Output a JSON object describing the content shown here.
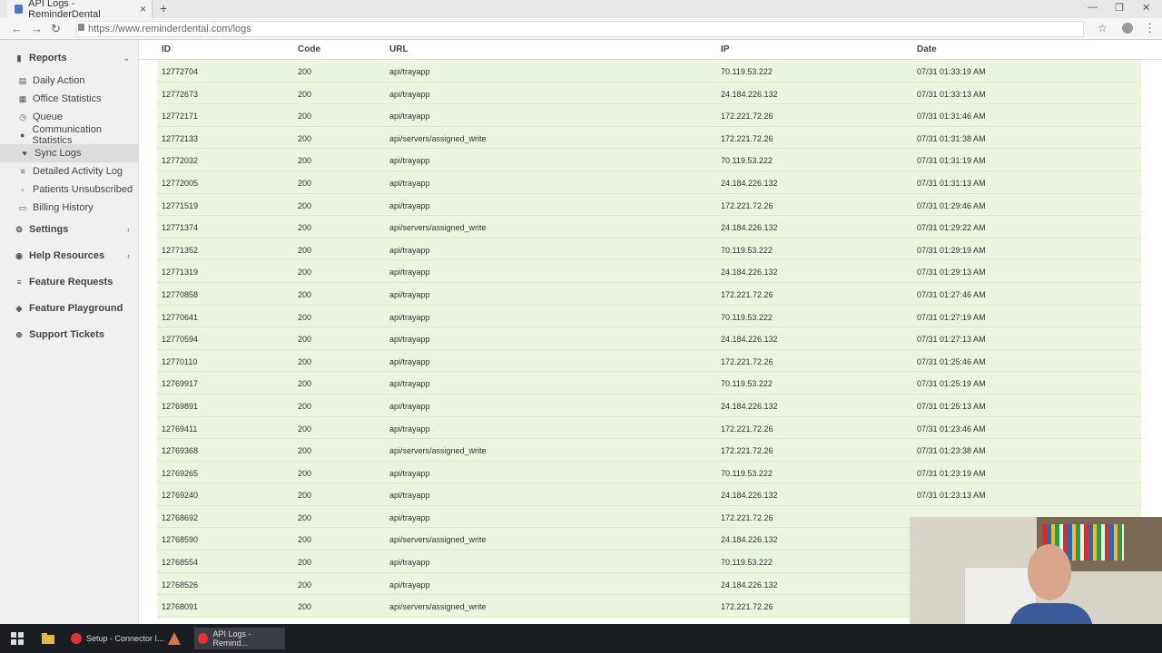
{
  "browser": {
    "tab_title": "API Logs - ReminderDental",
    "url": "https://www.reminderdental.com/logs"
  },
  "sidebar": {
    "reports": "Reports",
    "items": [
      {
        "label": "Daily Action",
        "icon": "calendar-icon"
      },
      {
        "label": "Office Statistics",
        "icon": "chart-icon"
      },
      {
        "label": "Queue",
        "icon": "clock-icon"
      },
      {
        "label": "Communication Statistics",
        "icon": "comment-icon"
      },
      {
        "label": "Sync Logs",
        "icon": "heart-icon"
      },
      {
        "label": "Detailed Activity Log",
        "icon": "list-icon"
      },
      {
        "label": "Patients Unsubscribed",
        "icon": "file-icon"
      },
      {
        "label": "Billing History",
        "icon": "card-icon"
      }
    ],
    "settings": "Settings",
    "help": "Help Resources",
    "features": "Feature Requests",
    "playground": "Feature Playground",
    "support": "Support Tickets"
  },
  "table": {
    "headers": {
      "id": "ID",
      "code": "Code",
      "url": "URL",
      "ip": "IP",
      "date": "Date"
    },
    "rows": [
      {
        "id": "12772704",
        "code": "200",
        "url": "api/trayapp",
        "ip": "70.119.53.222",
        "date": "07/31 01:33:19 AM"
      },
      {
        "id": "12772673",
        "code": "200",
        "url": "api/trayapp",
        "ip": "24.184.226.132",
        "date": "07/31 01:33:13 AM"
      },
      {
        "id": "12772171",
        "code": "200",
        "url": "api/trayapp",
        "ip": "172.221.72.26",
        "date": "07/31 01:31:46 AM"
      },
      {
        "id": "12772133",
        "code": "200",
        "url": "api/servers/assigned_write",
        "ip": "172.221.72.26",
        "date": "07/31 01:31:38 AM"
      },
      {
        "id": "12772032",
        "code": "200",
        "url": "api/trayapp",
        "ip": "70.119.53.222",
        "date": "07/31 01:31:19 AM"
      },
      {
        "id": "12772005",
        "code": "200",
        "url": "api/trayapp",
        "ip": "24.184.226.132",
        "date": "07/31 01:31:13 AM"
      },
      {
        "id": "12771519",
        "code": "200",
        "url": "api/trayapp",
        "ip": "172.221.72.26",
        "date": "07/31 01:29:46 AM"
      },
      {
        "id": "12771374",
        "code": "200",
        "url": "api/servers/assigned_write",
        "ip": "24.184.226.132",
        "date": "07/31 01:29:22 AM"
      },
      {
        "id": "12771352",
        "code": "200",
        "url": "api/trayapp",
        "ip": "70.119.53.222",
        "date": "07/31 01:29:19 AM"
      },
      {
        "id": "12771319",
        "code": "200",
        "url": "api/trayapp",
        "ip": "24.184.226.132",
        "date": "07/31 01:29:13 AM"
      },
      {
        "id": "12770858",
        "code": "200",
        "url": "api/trayapp",
        "ip": "172.221.72.26",
        "date": "07/31 01:27:46 AM"
      },
      {
        "id": "12770641",
        "code": "200",
        "url": "api/trayapp",
        "ip": "70.119.53.222",
        "date": "07/31 01:27:19 AM"
      },
      {
        "id": "12770594",
        "code": "200",
        "url": "api/trayapp",
        "ip": "24.184.226.132",
        "date": "07/31 01:27:13 AM"
      },
      {
        "id": "12770110",
        "code": "200",
        "url": "api/trayapp",
        "ip": "172.221.72.26",
        "date": "07/31 01:25:46 AM"
      },
      {
        "id": "12769917",
        "code": "200",
        "url": "api/trayapp",
        "ip": "70.119.53.222",
        "date": "07/31 01:25:19 AM"
      },
      {
        "id": "12769891",
        "code": "200",
        "url": "api/trayapp",
        "ip": "24.184.226.132",
        "date": "07/31 01:25:13 AM"
      },
      {
        "id": "12769411",
        "code": "200",
        "url": "api/trayapp",
        "ip": "172.221.72.26",
        "date": "07/31 01:23:46 AM"
      },
      {
        "id": "12769368",
        "code": "200",
        "url": "api/servers/assigned_write",
        "ip": "172.221.72.26",
        "date": "07/31 01:23:38 AM"
      },
      {
        "id": "12769265",
        "code": "200",
        "url": "api/trayapp",
        "ip": "70.119.53.222",
        "date": "07/31 01:23:19 AM"
      },
      {
        "id": "12769240",
        "code": "200",
        "url": "api/trayapp",
        "ip": "24.184.226.132",
        "date": "07/31 01:23:13 AM"
      },
      {
        "id": "12768692",
        "code": "200",
        "url": "api/trayapp",
        "ip": "172.221.72.26",
        "date": ""
      },
      {
        "id": "12768590",
        "code": "200",
        "url": "api/servers/assigned_write",
        "ip": "24.184.226.132",
        "date": ""
      },
      {
        "id": "12768554",
        "code": "200",
        "url": "api/trayapp",
        "ip": "70.119.53.222",
        "date": ""
      },
      {
        "id": "12768526",
        "code": "200",
        "url": "api/trayapp",
        "ip": "24.184.226.132",
        "date": ""
      },
      {
        "id": "12768091",
        "code": "200",
        "url": "api/servers/assigned_write",
        "ip": "172.221.72.26",
        "date": ""
      }
    ]
  },
  "taskbar": {
    "task1": "Setup - Connector I...",
    "task2": "API Logs - Remind..."
  }
}
